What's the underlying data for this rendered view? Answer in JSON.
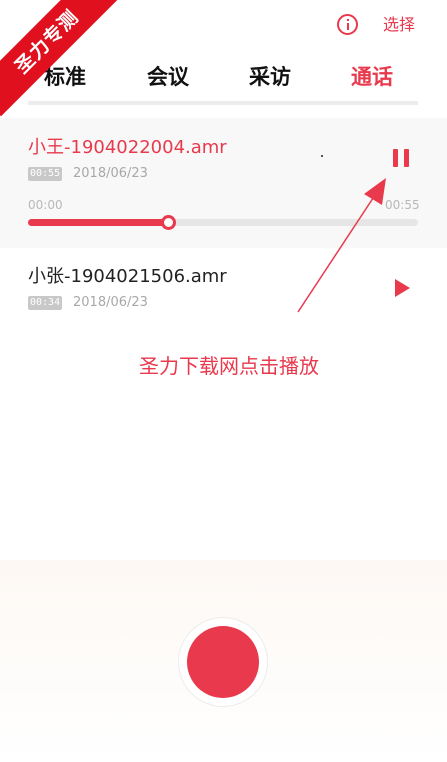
{
  "top_bar": {
    "info_icon": "info-icon",
    "select_label": "选择"
  },
  "watermark": {
    "text": "圣力专测"
  },
  "tabs": [
    {
      "label": "标准",
      "active": false
    },
    {
      "label": "会议",
      "active": false
    },
    {
      "label": "采访",
      "active": false
    },
    {
      "label": "通话",
      "active": true
    }
  ],
  "recordings": [
    {
      "name": "小王-1904022004.amr",
      "duration": "00:55",
      "date": "2018/06/23",
      "state": "playing",
      "progress": {
        "current": "00:00",
        "total": "00:55",
        "fraction": 0.36
      }
    },
    {
      "name": "小张-1904021506.amr",
      "duration": "00:34",
      "date": "2018/06/23",
      "state": "stopped"
    }
  ],
  "annotation": {
    "text": "圣力下载网点击播放"
  },
  "colors": {
    "accent": "#e8394d",
    "ribbon": "#e0101f"
  }
}
